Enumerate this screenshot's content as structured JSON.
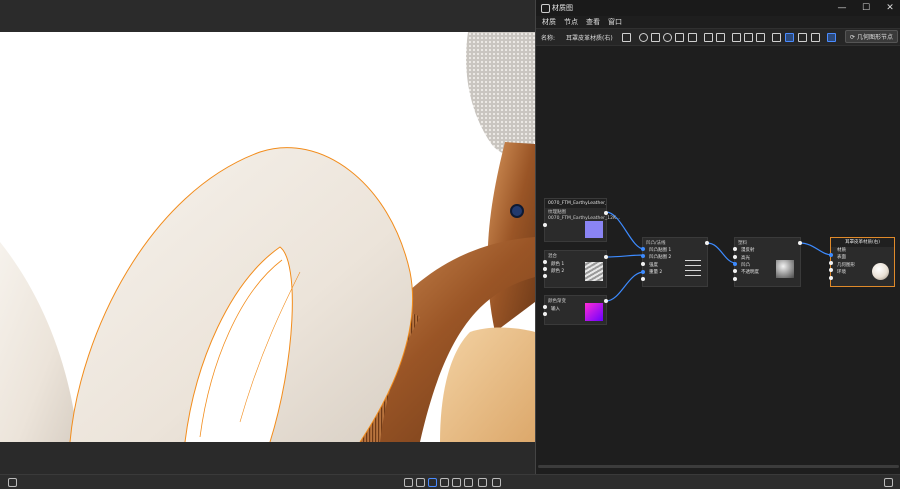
{
  "window": {
    "title": "材质图",
    "minimize": "—",
    "maximize": "☐",
    "close": "✕"
  },
  "menu": [
    "材质",
    "节点",
    "查看",
    "窗口"
  ],
  "toolbar": {
    "name_label": "名称:",
    "name_value": "耳罩皮革材质(右)",
    "geometry_button": "几何图形节点"
  },
  "nodes": {
    "texture": {
      "header": "0070_FTM_EarthyLeather_N...",
      "title": "纹理贴图",
      "file": "0070_FTM_EarthyLeather_12K..."
    },
    "blend": {
      "title": "混合",
      "port1": "颜色 1",
      "port2": "颜色 2"
    },
    "gradient": {
      "title": "颜色渐变",
      "port1": "输入"
    },
    "normal": {
      "title": "凹凸/法线",
      "port1": "凹凸贴图 1",
      "port2": "凹凸贴图 2",
      "port3": "强度",
      "port4": "重量 2"
    },
    "phong": {
      "title": "塑料",
      "port1": "漫反射",
      "port2": "高光",
      "port3": "凹凸",
      "port4": "不透明度"
    },
    "output": {
      "header": "耳罩皮革材质(右)",
      "title": "材质",
      "port1": "表面",
      "port2": "几何图形",
      "port3": "环境"
    }
  },
  "colors": {
    "accent": "#e08a2a",
    "link": "#3d8bff",
    "selection": "#f28c1b",
    "metal": "#b06a36",
    "cushion": "#f1ebe4"
  },
  "icons": {
    "toolbar": [
      "render-icon",
      "sphere-icon",
      "material-icon",
      "target-icon",
      "sliders-icon",
      "warning-icon",
      "copy-icon",
      "trash-icon",
      "layout-icon",
      "grid-icon",
      "tree-icon",
      "fit-icon",
      "frame-icon",
      "panel-icon",
      "link-icon",
      "refresh-icon"
    ]
  }
}
